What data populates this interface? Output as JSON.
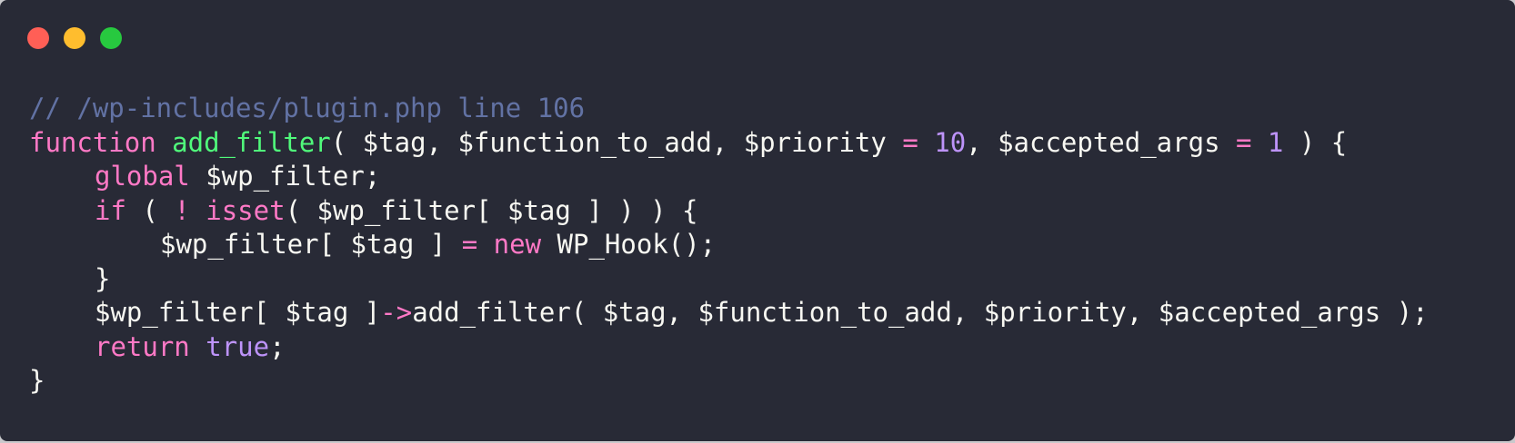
{
  "window": {
    "controls": {
      "close": "close-button",
      "minimize": "minimize-button",
      "maximize": "maximize-button"
    },
    "colors": {
      "background": "#282a36",
      "close": "#ff5f56",
      "minimize": "#ffbd2e",
      "maximize": "#27c93f"
    }
  },
  "code": {
    "comment": "// /wp-includes/plugin.php line 106",
    "l1": {
      "kw_function": "function",
      "fn_name": "add_filter",
      "p1": "( $tag, $function_to_add, $priority ",
      "eq1": "=",
      "num1": "10",
      "p2": ", $accepted_args ",
      "eq2": "=",
      "num2": "1",
      "p3": " ) {"
    },
    "l2": {
      "kw_global": "global",
      "rest": " $wp_filter;"
    },
    "l3": {
      "kw_if": "if",
      "p1": " ( ",
      "bang": "!",
      "p2": " ",
      "kw_isset": "isset",
      "p3": "( $wp_filter[ $tag ] ) ) {"
    },
    "l4": {
      "p1": "$wp_filter[ $tag ] ",
      "eq": "=",
      "p2": " ",
      "kw_new": "new",
      "p3": " WP_Hook();"
    },
    "l5": "}",
    "l6": {
      "p1": "$wp_filter[ $tag ]",
      "arrow": "->",
      "p2": "add_filter( $tag, $function_to_add, $priority, $accepted_args );"
    },
    "l7": {
      "kw_return": "return",
      "p1": " ",
      "kw_true": "true",
      "p2": ";"
    },
    "l8": "}"
  }
}
